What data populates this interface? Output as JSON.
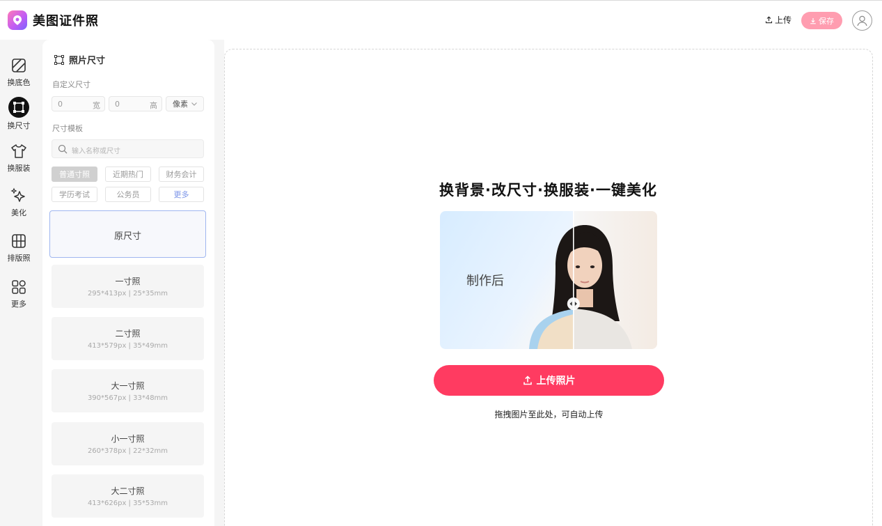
{
  "app": {
    "title": "美图证件照"
  },
  "header": {
    "upload_label": "上传",
    "save_label": "保存"
  },
  "rail": {
    "items": [
      {
        "label": "换底色",
        "icon": "background-swap-icon"
      },
      {
        "label": "换尺寸",
        "icon": "crop-size-icon",
        "active": true
      },
      {
        "label": "换服装",
        "icon": "tshirt-icon"
      },
      {
        "label": "美化",
        "icon": "sparkle-icon"
      },
      {
        "label": "排版照",
        "icon": "grid-icon"
      },
      {
        "label": "更多",
        "icon": "apps-icon"
      }
    ]
  },
  "panel": {
    "title": "照片尺寸",
    "custom_label": "自定义尺寸",
    "width_value": "0",
    "width_unit": "宽",
    "height_value": "0",
    "height_unit": "高",
    "unit_selected": "像素",
    "template_label": "尺寸模板",
    "search_placeholder": "输入名称或尺寸",
    "tags": [
      "普通寸照",
      "近期热门",
      "财务会计",
      "学历考试",
      "公务员",
      "更多"
    ],
    "sizes": [
      {
        "name": "原尺寸",
        "spec": ""
      },
      {
        "name": "一寸照",
        "spec": "295*413px | 25*35mm"
      },
      {
        "name": "二寸照",
        "spec": "413*579px | 35*49mm"
      },
      {
        "name": "大一寸照",
        "spec": "390*567px | 33*48mm"
      },
      {
        "name": "小一寸照",
        "spec": "260*378px | 22*32mm"
      },
      {
        "name": "大二寸照",
        "spec": "413*626px | 35*53mm"
      }
    ]
  },
  "main": {
    "headline": "换背景·改尺寸·换服装·一键美化",
    "preview_after_label": "制作后",
    "upload_button": "上传照片",
    "drop_hint": "拖拽图片至此处，可自动上传"
  },
  "colors": {
    "accent": "#ff3b61",
    "save_button": "#ff9db0",
    "selected_border": "#9fb6f0",
    "more_tag": "#7c95e8"
  }
}
